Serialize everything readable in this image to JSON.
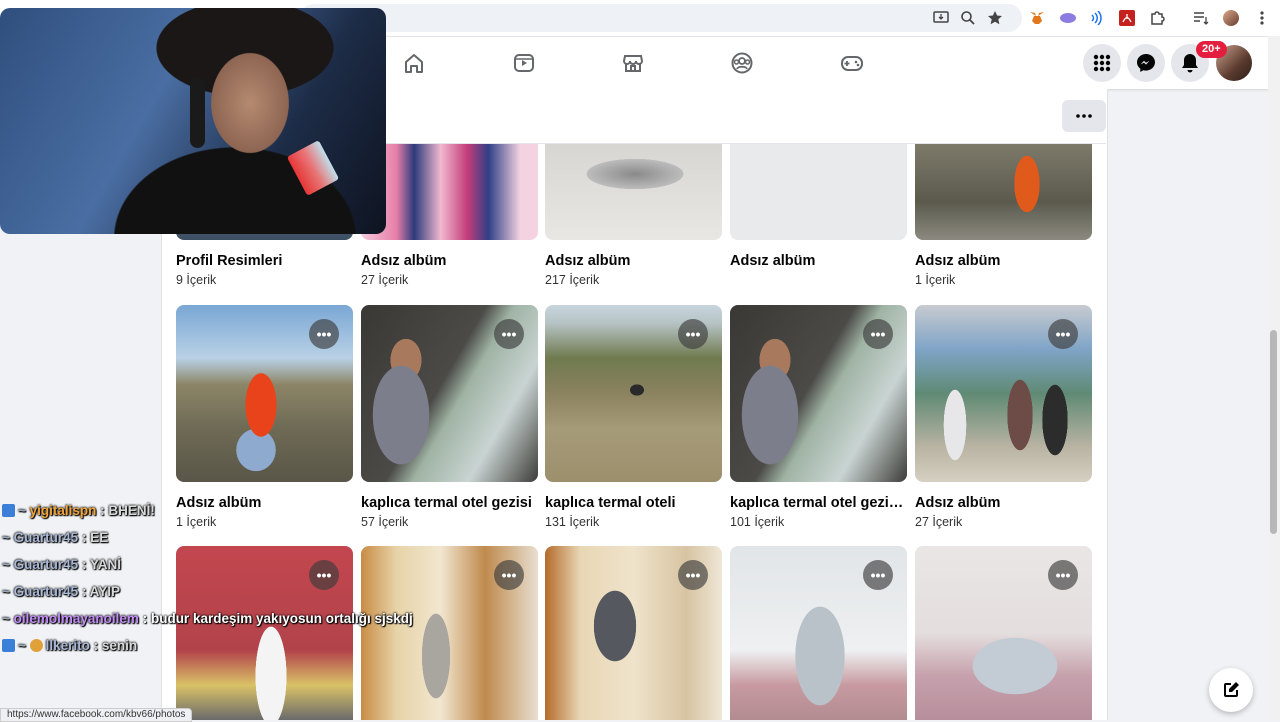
{
  "browser": {
    "toolbar_icons": [
      "install-icon",
      "zoom-icon",
      "bookmark-star-icon",
      "metamask-icon",
      "extension-purple-icon",
      "nfc-icon",
      "pdf-icon",
      "puzzle-icon",
      "tab-search-icon",
      "profile-icon",
      "menu-icon"
    ]
  },
  "fbnav": {
    "tabs": [
      "home-icon",
      "video-icon",
      "marketplace-icon",
      "groups-icon",
      "gaming-icon"
    ],
    "notification_badge": "20+"
  },
  "albums_row1": [
    {
      "name": "Profil Resimleri",
      "count": "9 İçerik"
    },
    {
      "name": "Adsız albüm",
      "count": "27 İçerik"
    },
    {
      "name": "Adsız albüm",
      "count": "217 İçerik"
    },
    {
      "name": "Adsız albüm",
      "count": ""
    },
    {
      "name": "Adsız albüm",
      "count": "1 İçerik"
    }
  ],
  "albums_row2": [
    {
      "name": "Adsız albüm",
      "count": "1 İçerik"
    },
    {
      "name": "kaplıca termal otel gezisi",
      "count": "57 İçerik"
    },
    {
      "name": "kaplıca termal oteli",
      "count": "131 İçerik"
    },
    {
      "name": "kaplıca termal otel gezisi...",
      "count": "101 İçerik"
    },
    {
      "name": "Adsız albüm",
      "count": "27 İçerik"
    }
  ],
  "dots_label": "•••",
  "chat": [
    {
      "user": "yigitalispn",
      "msg": ": BHENİ!",
      "color": "#f0a43a"
    },
    {
      "user": "Guartur45",
      "msg": ": EE",
      "color": "#a9b8d6"
    },
    {
      "user": "Guartur45",
      "msg": ": YANİ",
      "color": "#a9b8d6"
    },
    {
      "user": "Guartur45",
      "msg": ": AYIP",
      "color": "#a9b8d6"
    },
    {
      "user": "oilemolmayanoilem",
      "msg": ": budur kardeşim yakıyosun ortalığı sjskdj",
      "color": "#c18cf5"
    },
    {
      "user": "llkerito",
      "msg": ": senin",
      "color": "#a9b8d6"
    }
  ],
  "status_url": "https://www.facebook.com/kbv66/photos"
}
